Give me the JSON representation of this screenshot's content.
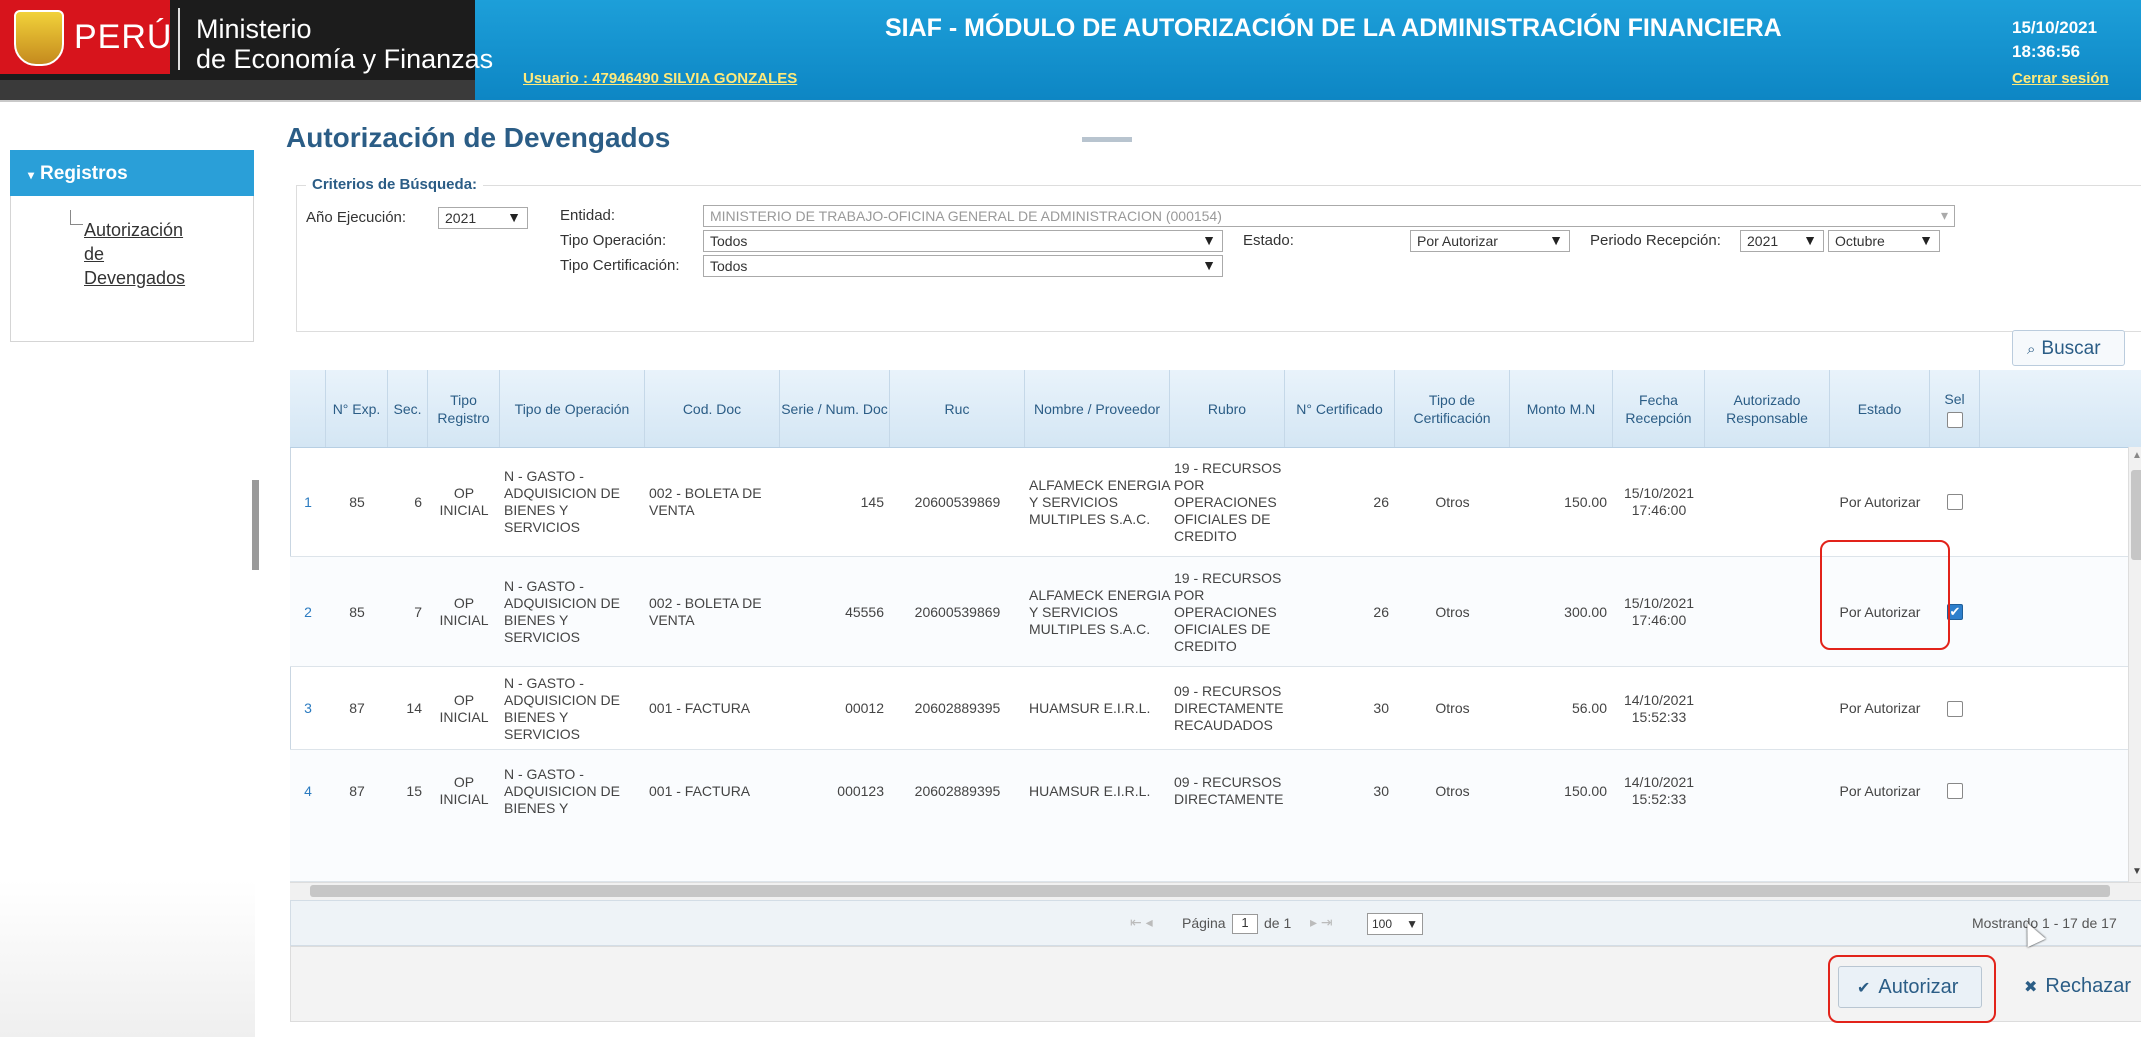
{
  "header": {
    "country": "PERÚ",
    "ministry_line1": "Ministerio",
    "ministry_line2": "de Economía y Finanzas",
    "app_title": "SIAF - MÓDULO DE AUTORIZACIÓN DE LA ADMINISTRACIÓN FINANCIERA",
    "user": "Usuario : 47946490 SILVIA GONZALES",
    "date": "15/10/2021",
    "time": "18:36:56",
    "logout": "Cerrar sesión"
  },
  "sidebar": {
    "section": "Registros",
    "link": "Autorización de Devengados"
  },
  "page_title": "Autorización de Devengados",
  "criteria": {
    "title": "Criterios de Búsqueda:",
    "anio_label": "Año Ejecución:",
    "anio_value": "2021",
    "entidad_label": "Entidad:",
    "entidad_value": "MINISTERIO DE TRABAJO-OFICINA GENERAL DE ADMINISTRACION (000154)",
    "tipo_op_label": "Tipo Operación:",
    "tipo_op_value": "Todos",
    "estado_label": "Estado:",
    "estado_value": "Por Autorizar",
    "periodo_label": "Periodo Recepción:",
    "periodo_anio": "2021",
    "periodo_mes": "Octubre",
    "tipo_cert_label": "Tipo Certificación:",
    "tipo_cert_value": "Todos",
    "buscar": "Buscar"
  },
  "table": {
    "columns": [
      "N° Exp.",
      "Sec.",
      "Tipo Registro",
      "Tipo de Operación",
      "Cod. Doc",
      "Serie / Num. Doc",
      "Ruc",
      "Nombre / Proveedor",
      "Rubro",
      "N° Certificado",
      "Tipo de Certificación",
      "Monto M.N",
      "Fecha Recepción",
      "Autorizado Responsable",
      "Estado",
      "Sel"
    ],
    "rows": [
      {
        "n": "1",
        "exp": "85",
        "sec": "6",
        "tipo_reg": "OP INICIAL",
        "tipo_op": "N - GASTO - ADQUISICION DE BIENES Y SERVICIOS",
        "cod_doc": "002 - BOLETA DE VENTA",
        "serie": "145",
        "ruc": "20600539869",
        "nombre": "ALFAMECK ENERGIA Y SERVICIOS MULTIPLES S.A.C.",
        "rubro": "19 - RECURSOS POR OPERACIONES OFICIALES DE CREDITO",
        "cert": "26",
        "tipo_cert": "Otros",
        "monto": "150.00",
        "fecha": "15/10/2021 17:46:00",
        "resp": "",
        "estado": "Por Autorizar",
        "sel": false
      },
      {
        "n": "2",
        "exp": "85",
        "sec": "7",
        "tipo_reg": "OP INICIAL",
        "tipo_op": "N - GASTO - ADQUISICION DE BIENES Y SERVICIOS",
        "cod_doc": "002 - BOLETA DE VENTA",
        "serie": "45556",
        "ruc": "20600539869",
        "nombre": "ALFAMECK ENERGIA Y SERVICIOS MULTIPLES S.A.C.",
        "rubro": "19 - RECURSOS POR OPERACIONES OFICIALES DE CREDITO",
        "cert": "26",
        "tipo_cert": "Otros",
        "monto": "300.00",
        "fecha": "15/10/2021 17:46:00",
        "resp": "",
        "estado": "Por Autorizar",
        "sel": true
      },
      {
        "n": "3",
        "exp": "87",
        "sec": "14",
        "tipo_reg": "OP INICIAL",
        "tipo_op": "N - GASTO - ADQUISICION DE BIENES Y SERVICIOS",
        "cod_doc": "001 - FACTURA",
        "serie": "00012",
        "ruc": "20602889395",
        "nombre": "HUAMSUR E.I.R.L.",
        "rubro": "09 - RECURSOS DIRECTAMENTE RECAUDADOS",
        "cert": "30",
        "tipo_cert": "Otros",
        "monto": "56.00",
        "fecha": "14/10/2021 15:52:33",
        "resp": "",
        "estado": "Por Autorizar",
        "sel": false
      },
      {
        "n": "4",
        "exp": "87",
        "sec": "15",
        "tipo_reg": "OP INICIAL",
        "tipo_op": "N - GASTO - ADQUISICION DE BIENES Y",
        "cod_doc": "001 - FACTURA",
        "serie": "000123",
        "ruc": "20602889395",
        "nombre": "HUAMSUR E.I.R.L.",
        "rubro": "09 - RECURSOS DIRECTAMENTE",
        "cert": "30",
        "tipo_cert": "Otros",
        "monto": "150.00",
        "fecha": "14/10/2021 15:52:33",
        "resp": "",
        "estado": "Por Autorizar",
        "sel": false
      }
    ]
  },
  "pager": {
    "page_label": "Página",
    "page_value": "1",
    "of_label": "de 1",
    "page_size": "100",
    "records": "Mostrando 1 - 17 de 17"
  },
  "actions": {
    "autorizar": "Autorizar",
    "rechazar": "Rechazar"
  },
  "colors": {
    "header_blue": "#1d9fd9",
    "brand_red": "#d7141c",
    "highlight_red": "#e2231a",
    "title_blue": "#2b5d86"
  }
}
